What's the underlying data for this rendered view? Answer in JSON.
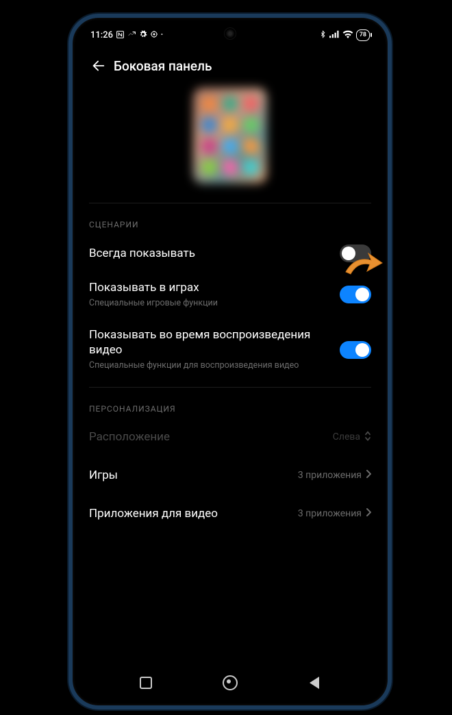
{
  "status": {
    "time": "11:26",
    "icons_left": [
      "nfc-icon",
      "link-icon",
      "gear-icon",
      "compass-icon",
      "dot-icon"
    ],
    "icons_right": [
      "bluetooth-icon",
      "signal-icon",
      "wifi-icon"
    ],
    "battery": "78"
  },
  "header": {
    "title": "Боковая панель"
  },
  "sections": {
    "scenarios_header": "СЦЕНАРИИ",
    "always_show": {
      "title": "Всегда показывать",
      "on": false
    },
    "show_in_games": {
      "title": "Показывать в играх",
      "sub": "Специальные игровые функции",
      "on": true
    },
    "show_in_video": {
      "title": "Показывать во время воспроизведения видео",
      "sub": "Специальные функции для воспроизведения видео",
      "on": true
    },
    "personalization_header": "ПЕРСОНАЛИЗАЦИЯ",
    "position": {
      "title": "Расположение",
      "value": "Слева"
    },
    "games": {
      "title": "Игры",
      "value": "3 приложения"
    },
    "video_apps": {
      "title": "Приложения для видео",
      "value": "3 приложения"
    }
  }
}
